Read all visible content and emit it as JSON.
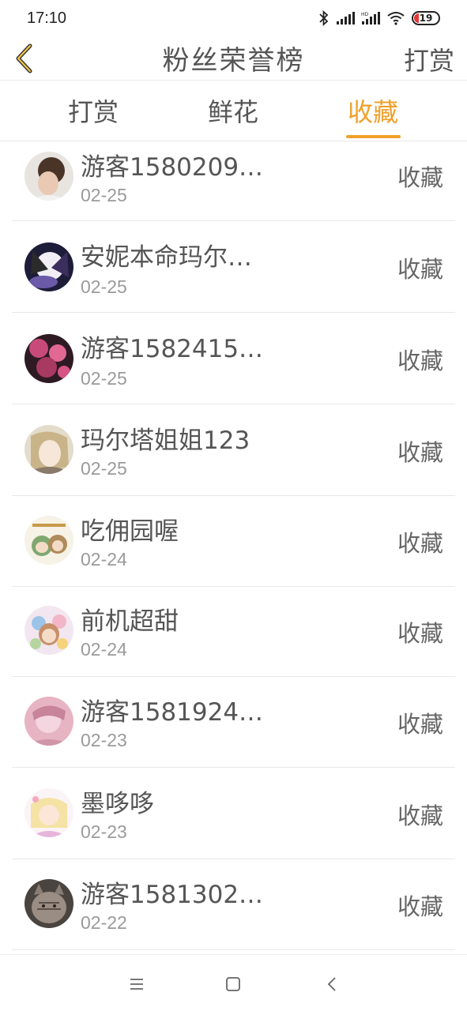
{
  "status_bar": {
    "time": "17:10",
    "battery": "19"
  },
  "header": {
    "title": "粉丝荣誉榜",
    "action": "打赏"
  },
  "tabs": [
    {
      "label": "打赏",
      "active": false
    },
    {
      "label": "鲜花",
      "active": false
    },
    {
      "label": "收藏",
      "active": true
    }
  ],
  "accent_color": "#f0a02a",
  "list": [
    {
      "name": "游客1580209…",
      "date": "02-25",
      "action": "收藏"
    },
    {
      "name": "安妮本命玛尔…",
      "date": "02-25",
      "action": "收藏"
    },
    {
      "name": "游客1582415…",
      "date": "02-25",
      "action": "收藏"
    },
    {
      "name": "玛尔塔姐姐123",
      "date": "02-25",
      "action": "收藏"
    },
    {
      "name": "吃佣园喔",
      "date": "02-24",
      "action": "收藏"
    },
    {
      "name": "前机超甜",
      "date": "02-24",
      "action": "收藏"
    },
    {
      "name": "游客1581924…",
      "date": "02-23",
      "action": "收藏"
    },
    {
      "name": "墨哆哆",
      "date": "02-23",
      "action": "收藏"
    },
    {
      "name": "游客1581302…",
      "date": "02-22",
      "action": "收藏"
    }
  ],
  "icons": {
    "back": "chevron-left-icon",
    "nav_menu": "menu-icon",
    "nav_home": "square-icon",
    "nav_back": "back-icon"
  }
}
